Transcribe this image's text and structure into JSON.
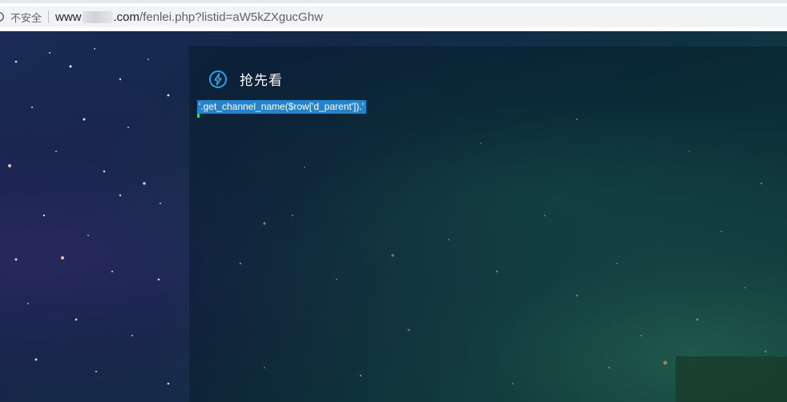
{
  "browser": {
    "security_label": "不安全",
    "url_prefix": "www",
    "url_rest": ".com",
    "url_path": "/fenlei.php?listid=aW5kZXgucGhw"
  },
  "panel": {
    "title": "抢先看",
    "code_text": "'.get_channel_name($row['d_parent']).'"
  },
  "colors": {
    "page_top": "#1a2a55",
    "page_bottom_right": "#174a47",
    "selection": "#2783c9",
    "icon_accent": "#2aa3e0"
  },
  "icons": {
    "info": "info-icon",
    "bolt": "lightning-circle-icon"
  }
}
